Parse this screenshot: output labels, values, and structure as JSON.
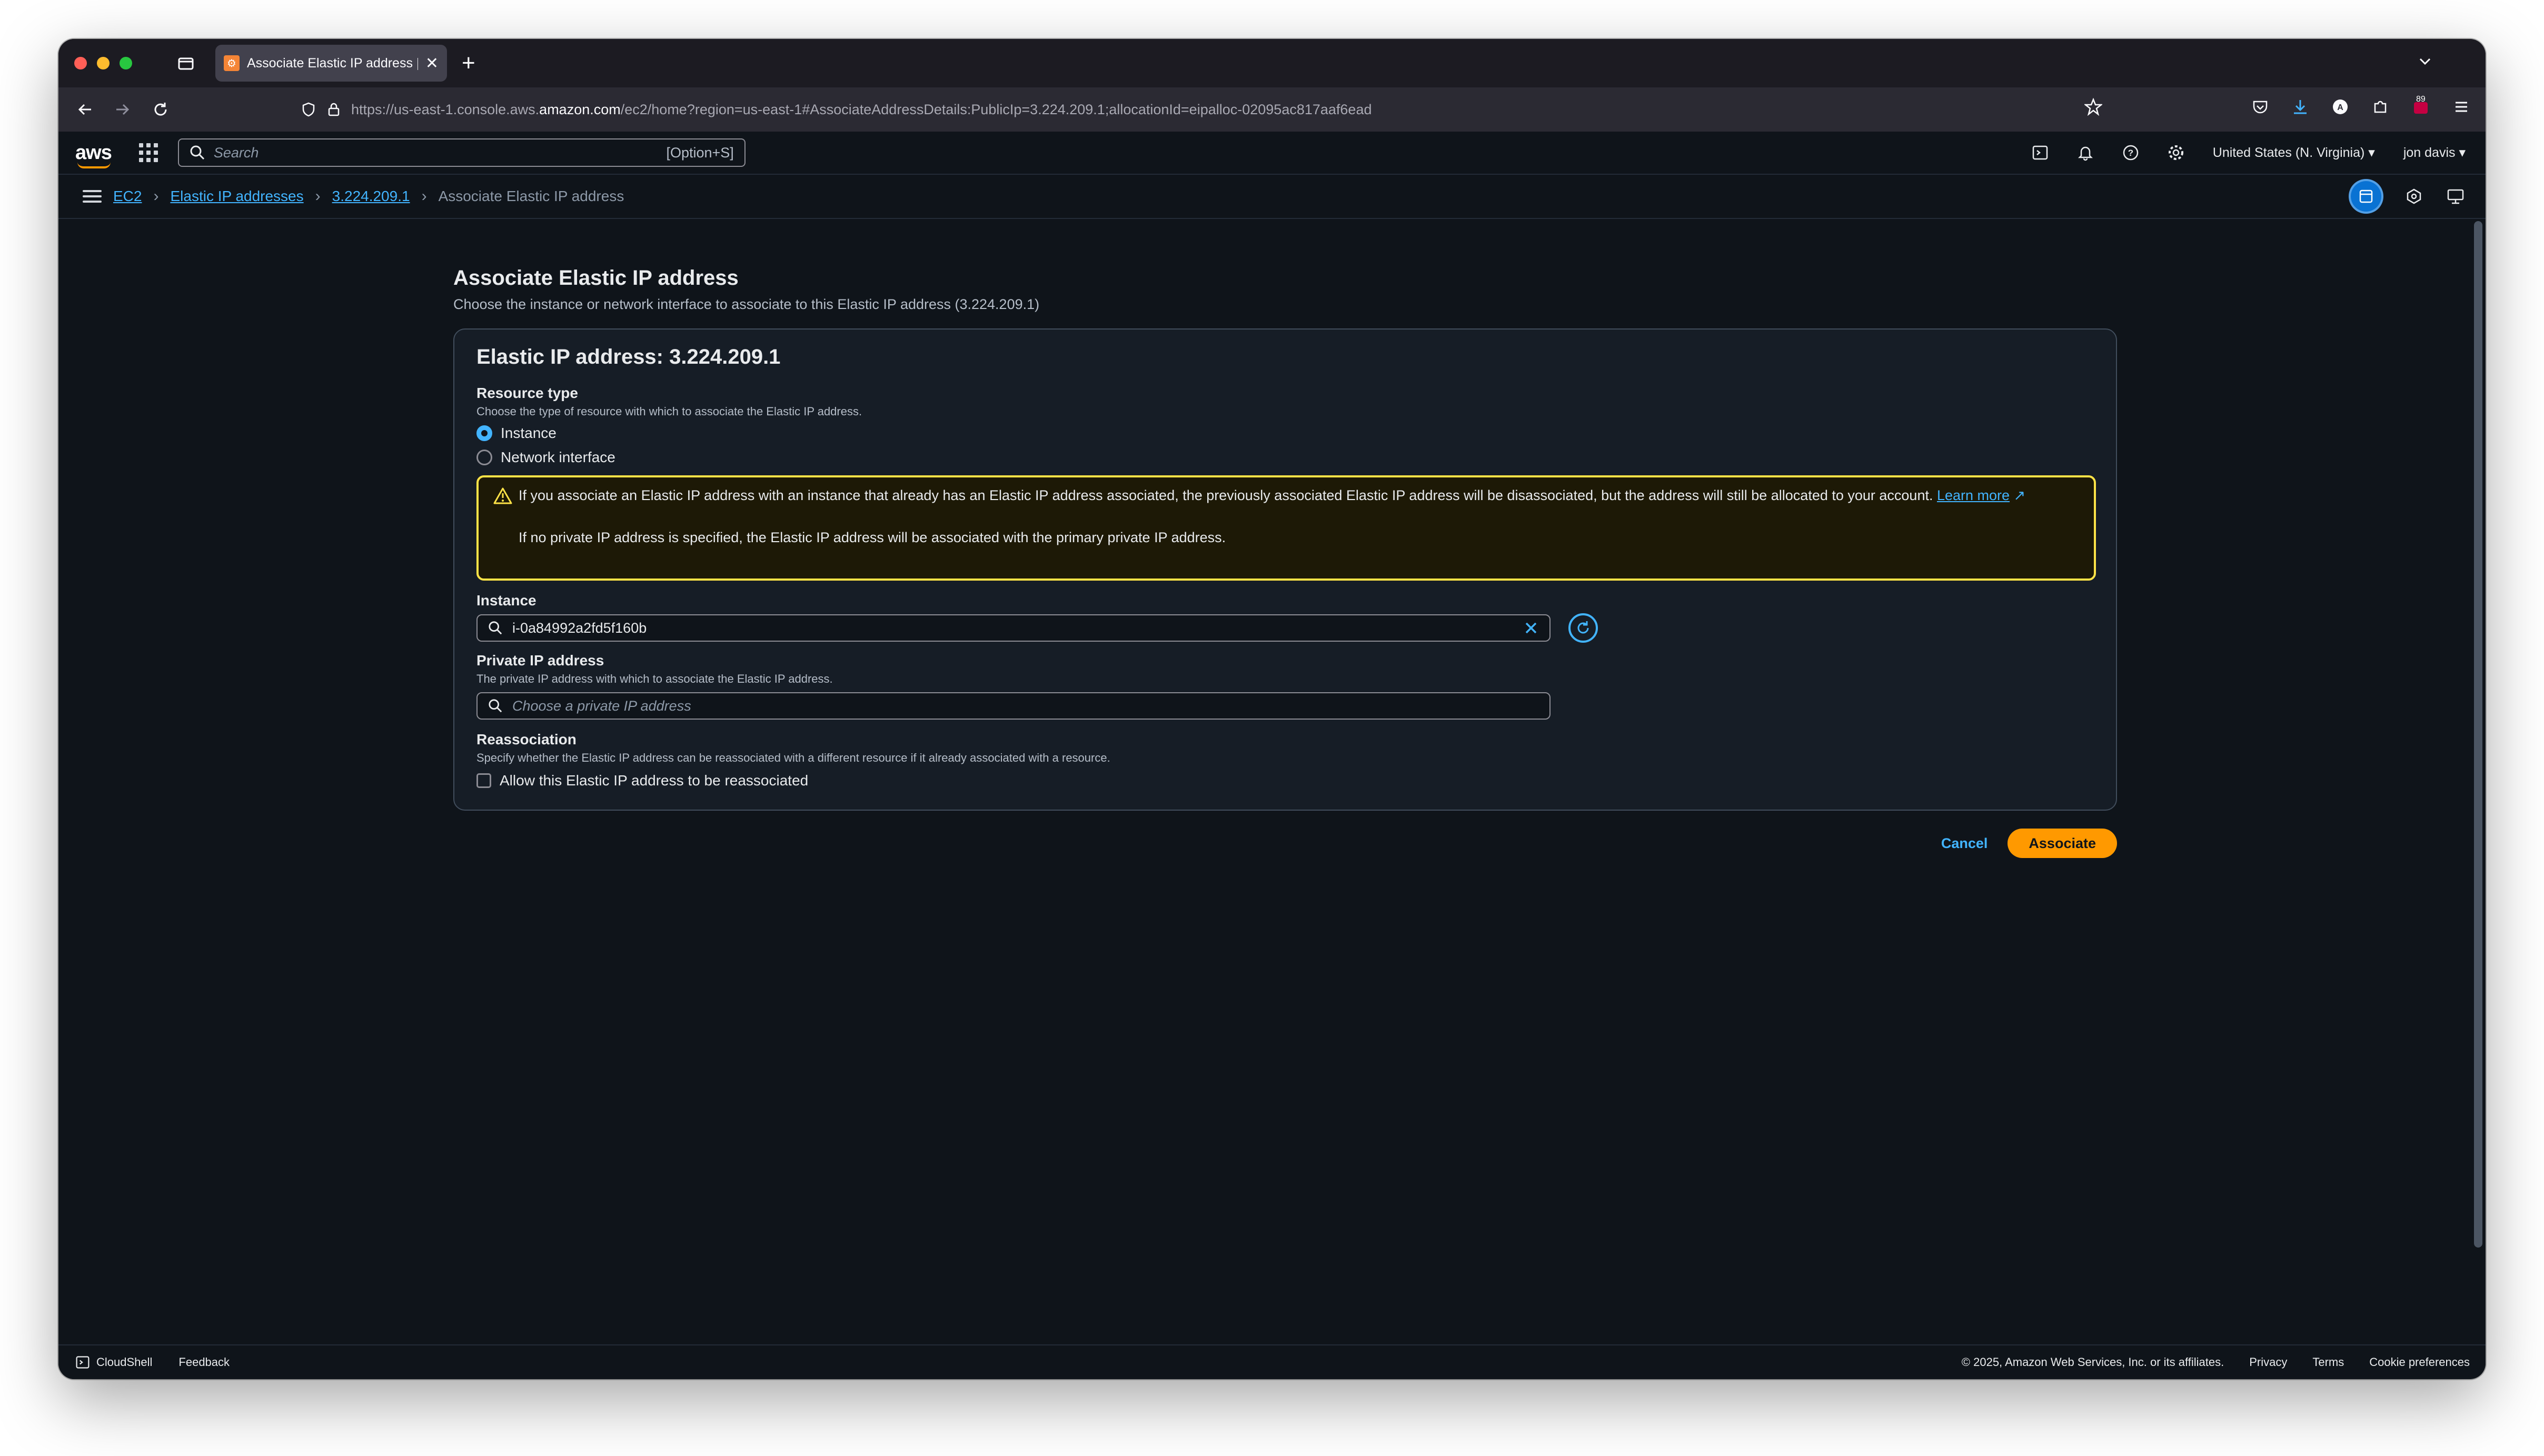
{
  "browser": {
    "tab_title": "Associate Elastic IP address | EC",
    "url_prefix": "https://us-east-1.console.aws.",
    "url_domain": "amazon.com",
    "url_suffix": "/ec2/home?region=us-east-1#AssociateAddressDetails:PublicIp=3.224.209.1;allocationId=eipalloc-02095ac817aaf6ead",
    "extension_badge": "89"
  },
  "aws_nav": {
    "logo": "aws",
    "search_placeholder": "Search",
    "search_shortcut": "[Option+S]",
    "region": "United States (N. Virginia) ▾",
    "user": "jon davis ▾"
  },
  "breadcrumb": {
    "items": [
      "EC2",
      "Elastic IP addresses",
      "3.224.209.1"
    ],
    "current": "Associate Elastic IP address",
    "separator": "›"
  },
  "page": {
    "title": "Associate Elastic IP address",
    "description": "Choose the instance or network interface to associate to this Elastic IP address (3.224.209.1)"
  },
  "form": {
    "container_title": "Elastic IP address: 3.224.209.1",
    "resource_type": {
      "label": "Resource type",
      "description": "Choose the type of resource with which to associate the Elastic IP address.",
      "options": [
        "Instance",
        "Network interface"
      ],
      "selected": "Instance"
    },
    "alert": {
      "text": "If you associate an Elastic IP address with an instance that already has an Elastic IP address associated, the previously associated Elastic IP address will be disassociated, but the address will still be allocated to your account. ",
      "link": "Learn more",
      "text2": "If no private IP address is specified, the Elastic IP address will be associated with the primary private IP address."
    },
    "instance": {
      "label": "Instance",
      "value": "i-0a84992a2fd5f160b"
    },
    "private_ip": {
      "label": "Private IP address",
      "description": "The private IP address with which to associate the Elastic IP address.",
      "placeholder": "Choose a private IP address"
    },
    "reassociation": {
      "label": "Reassociation",
      "description": "Specify whether the Elastic IP address can be reassociated with a different resource if it already associated with a resource.",
      "checkbox_label": "Allow this Elastic IP address to be reassociated",
      "checked": false
    },
    "cancel_label": "Cancel",
    "submit_label": "Associate"
  },
  "footer": {
    "cloudshell": "CloudShell",
    "feedback": "Feedback",
    "copyright": "© 2025, Amazon Web Services, Inc. or its affiliates.",
    "links": [
      "Privacy",
      "Terms",
      "Cookie preferences"
    ]
  },
  "colors": {
    "link": "#42b4ff",
    "primary_button": "#ff9900",
    "warning_border": "#ffe347",
    "background": "#0f141a"
  }
}
